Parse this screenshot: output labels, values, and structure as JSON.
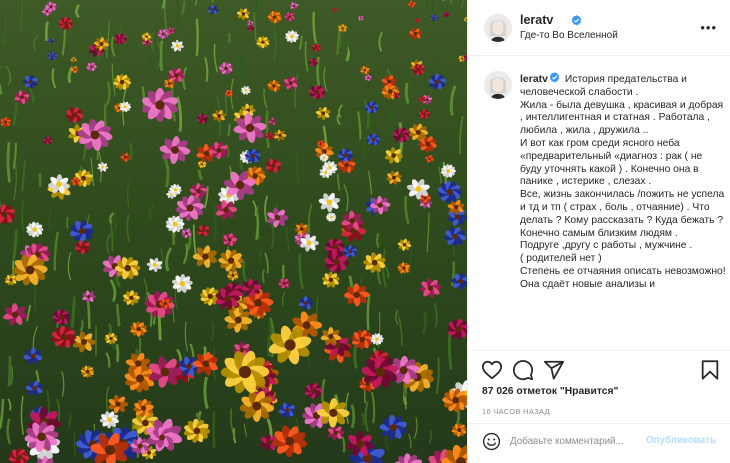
{
  "post": {
    "username": "leratv",
    "location": "Где-то Во Вселенной",
    "more_label": "•••",
    "caption_body": " История предательства и человеческой слабости .\nЖила - была девушка , красивая и добрая , интеллигентная и статная . Работала , любила , жила , дружила ..\nИ вот как гром среди ясного неба «предварительный «диагноз : рак ( не буду уточнять какой ) . Конечно она в панике , истерике , слезах .\nВсе, жизнь закончилась /пожить не успела и тд и тп ( страх , боль , отчаяние) . Что делать ? Кому рассказать ? Куда бежать ?\nКонечно самым близким людям .\nПодруге ,другу с работы , мужчине .\n( родителей нет )\nСтепень ее отчаяния описать невозможно!\nОна сдаёт новые анализы и",
    "likes": "87 026 отметок \"Нравится\"",
    "time": "16 часов назад",
    "comment_placeholder": "Добавьте комментарий...",
    "publish_label": "Опубликовать"
  },
  "icons": {
    "like": "heart-icon",
    "comment": "comment-icon",
    "share": "paper-plane-icon",
    "save": "bookmark-icon",
    "emoji": "smiley-icon",
    "verified": "verified-badge-icon"
  },
  "colors": {
    "verified": "#3897f0",
    "publish_disabled": "#b2dffc",
    "secondary_text": "#8e8e8e",
    "border": "#efefef"
  }
}
